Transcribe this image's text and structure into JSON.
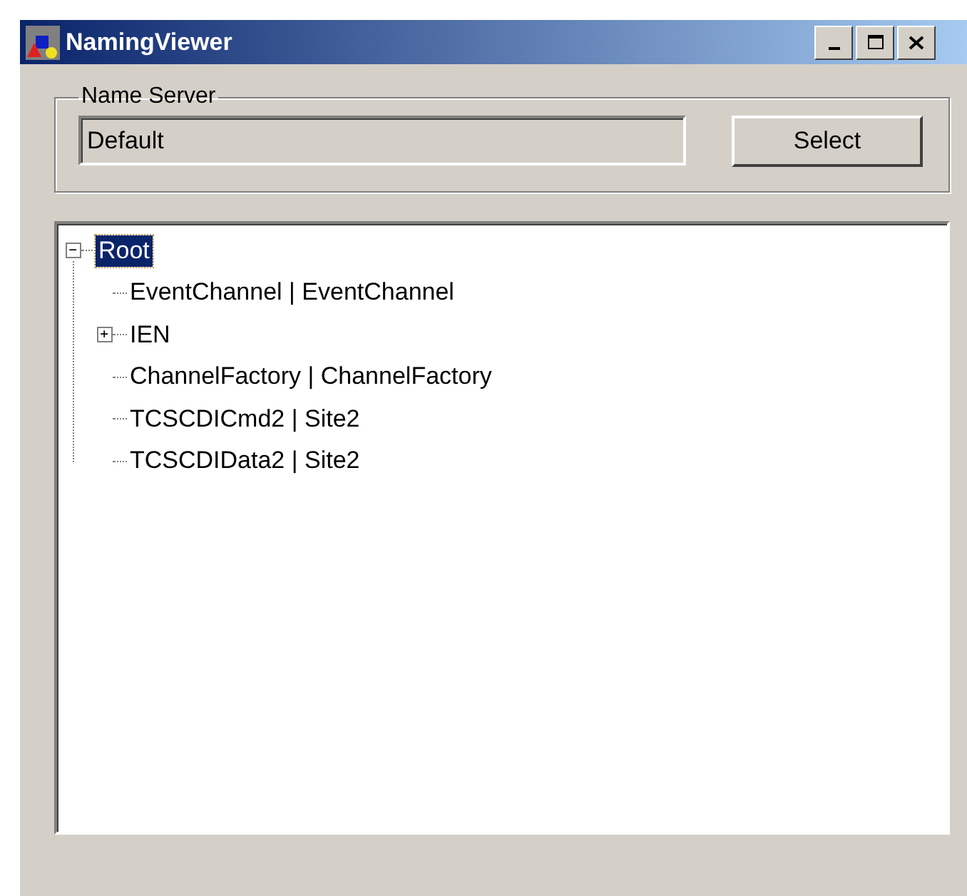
{
  "window": {
    "title": "NamingViewer"
  },
  "name_server": {
    "label": "Name Server",
    "value": "Default",
    "button": "Select"
  },
  "tree": [
    {
      "label": "Root",
      "selected": true,
      "expanded": true,
      "children": [
        {
          "label": "EventChannel | EventChannel",
          "selected": false
        },
        {
          "label": "IEN",
          "selected": false,
          "expanded": false
        },
        {
          "label": "ChannelFactory | ChannelFactory",
          "selected": false
        },
        {
          "label": "TCSCDICmd2 | Site2",
          "selected": false
        },
        {
          "label": "TCSCDIData2 | Site2",
          "selected": false
        }
      ]
    }
  ]
}
